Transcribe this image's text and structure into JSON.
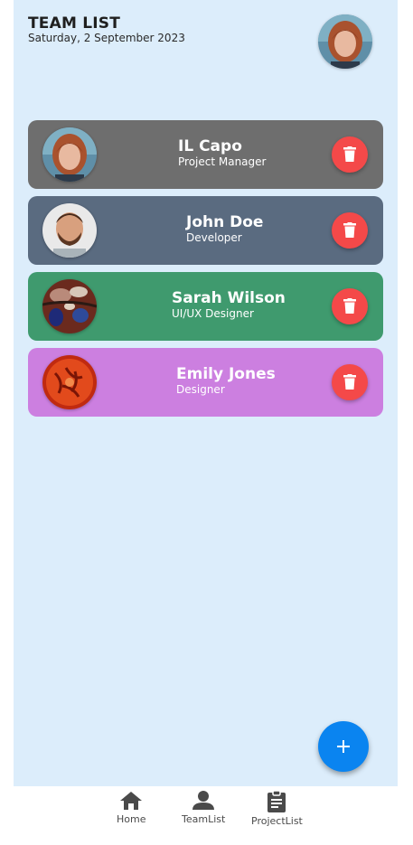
{
  "header": {
    "title": "TEAM LIST",
    "date": "Saturday, 2 September 2023"
  },
  "team": [
    {
      "name": "IL Capo",
      "role": "Project Manager",
      "color": "#6e6e6e",
      "avatar": "woman-red-hair"
    },
    {
      "name": "John Doe",
      "role": "Developer",
      "color": "#5a6b80",
      "avatar": "man-beard"
    },
    {
      "name": "Sarah Wilson",
      "role": "UI/UX Designer",
      "color": "#3f9a6e",
      "avatar": "abstract-pattern"
    },
    {
      "name": "Emily Jones",
      "role": "Designer",
      "color": "#cc7fe0",
      "avatar": "red-abstract"
    }
  ],
  "colors": {
    "background": "#dcedfb",
    "delete": "#f44949",
    "fab": "#0a84f0"
  },
  "icons": {
    "delete": "trash-icon",
    "add": "plus-icon"
  },
  "nav": {
    "items": [
      {
        "label": "Home",
        "icon": "home-icon"
      },
      {
        "label": "TeamList",
        "icon": "person-icon"
      },
      {
        "label": "ProjectList",
        "icon": "clipboard-icon"
      }
    ]
  }
}
